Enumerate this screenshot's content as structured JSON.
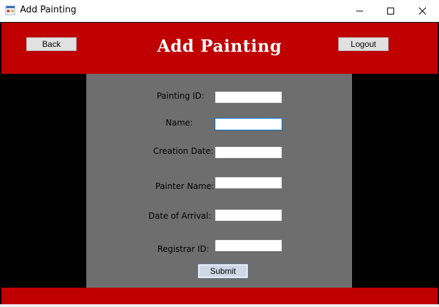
{
  "window": {
    "title": "Add Painting",
    "app_icon": "form-window-icon",
    "controls": {
      "minimize_icon": "minimize-icon",
      "maximize_icon": "maximize-icon",
      "close_icon": "close-icon"
    }
  },
  "header": {
    "heading": "Add Painting",
    "back_label": "Back",
    "logout_label": "Logout"
  },
  "form": {
    "fields": [
      {
        "label": "Painting ID:",
        "value": ""
      },
      {
        "label": "Name:",
        "value": ""
      },
      {
        "label": "Creation Date:",
        "value": ""
      },
      {
        "label": "Painter Name:",
        "value": ""
      },
      {
        "label": "Date of Arrival:",
        "value": ""
      },
      {
        "label": "Registrar ID:",
        "value": ""
      }
    ],
    "focused_field": "Name:",
    "submit_label": "Submit"
  },
  "colors": {
    "header_bg": "#c00000",
    "panel_bg": "#6e6e6e",
    "sides_bg": "#000000",
    "heading_text": "#ffffff"
  }
}
